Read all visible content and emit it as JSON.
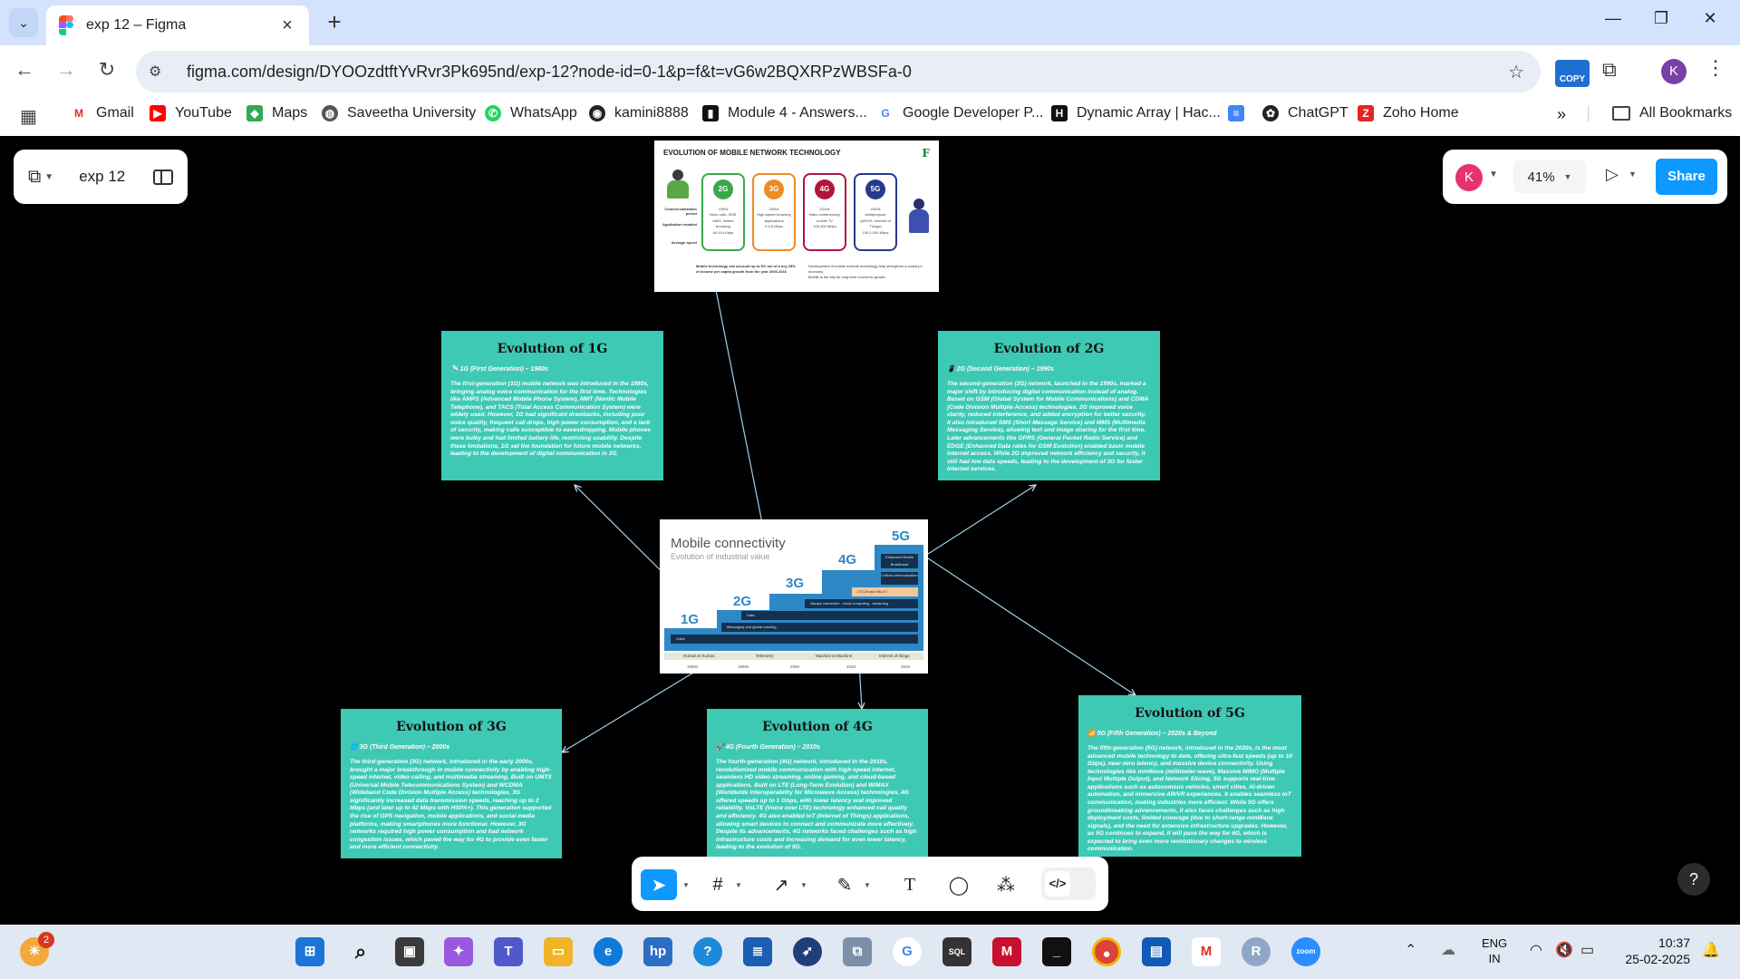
{
  "browser": {
    "tab_title": "exp 12 – Figma",
    "url": "figma.com/design/DYOOzdtftYvRvr3Pk695nd/exp-12?node-id=0-1&p=f&t=vG6w2BQXRPzWBSFa-0",
    "copy_extension_label": "COPY",
    "profile_initial": "K",
    "bookmarks": [
      "Gmail",
      "YouTube",
      "Maps",
      "Saveetha University",
      "WhatsApp",
      "kamini8888",
      "Module 4 - Answers...",
      "Google Developer P...",
      "Dynamic Array | Hac...",
      "ChatGPT",
      "Zoho Home"
    ],
    "all_bookmarks": "All Bookmarks"
  },
  "figma": {
    "file_name": "exp 12",
    "user_initial": "K",
    "zoom": "41%",
    "share_label": "Share",
    "help_label": "?"
  },
  "image_evolution": {
    "title": "EVOLUTION OF MOBILE NETWORK TECHNOLOGY",
    "row_labels": [
      "Commercialization period",
      "Application enabled",
      "Average speed"
    ],
    "generations": [
      {
        "badge": "2G",
        "period": "1990s",
        "apps": "Voice calls, SMS, MMS, limited browsing",
        "speed": "64-114 Kbps",
        "color": "#3aa84a"
      },
      {
        "badge": "3G",
        "period": "2000s",
        "apps": "High-speed browsing applications",
        "speed": "0.5-5 Mbps",
        "color": "#f08a24"
      },
      {
        "badge": "4G",
        "period": "2010s",
        "apps": "Video conferencing, mobile TV",
        "speed": "100-300 Mbps",
        "color": "#b0163a"
      },
      {
        "badge": "5G",
        "period": "2020s",
        "apps": "Multipurpose (AR/VR, Internet of Things)",
        "speed": "100-1,000 Mbps",
        "color": "#253a8c"
      }
    ],
    "note_left": "Mobile technology can account up to 5% out of a key 25% of income per capita growth from the year 2000-2016",
    "note_right_1": "Development of mobile network technology help strengthen a country's economy",
    "note_right_2": "Mobile is the key for long term economic growth"
  },
  "frame_1g": {
    "title": "Evolution of 1G",
    "subtitle": "📡 1G (First Generation) – 1980s",
    "body": "The first-generation (1G) mobile network was introduced in the 1980s, bringing analog voice communication for the first time. Technologies like AMPS (Advanced Mobile Phone System), NMT (Nordic Mobile Telephone), and TACS (Total Access Communication System) were widely used. However, 1G had significant drawbacks, including poor voice quality, frequent call drops, high power consumption, and a lack of security, making calls susceptible to eavesdropping. Mobile phones were bulky and had limited battery life, restricting usability. Despite these limitations, 1G set the foundation for future mobile networks, leading to the development of digital communication in 2G."
  },
  "frame_2g": {
    "title": "Evolution of 2G",
    "subtitle": "📱 2G (Second Generation) – 1990s",
    "body": "The second-generation (2G) network, launched in the 1990s, marked a major shift by introducing digital communication instead of analog. Based on GSM (Global System for Mobile Communications) and CDMA (Code Division Multiple Access) technologies, 2G improved voice clarity, reduced interference, and added encryption for better security. It also introduced SMS (Short Message Service) and MMS (Multimedia Messaging Service), allowing text and image sharing for the first time. Later advancements like GPRS (General Packet Radio Service) and EDGE (Enhanced Data rates for GSM Evolution) enabled basic mobile internet access. While 2G improved network efficiency and security, it still had low data speeds, leading to the development of 3G for faster internet services."
  },
  "frame_3g": {
    "title": "Evolution of 3G",
    "subtitle": "🌐 3G (Third Generation) – 2000s",
    "body": "The third-generation (3G) network, introduced in the early 2000s, brought a major breakthrough in mobile connectivity by enabling high-speed internet, video calling, and multimedia streaming. Built on UMTS (Universal Mobile Telecommunications System) and WCDMA (Wideband Code Division Multiple Access) technologies, 3G significantly increased data transmission speeds, reaching up to 2 Mbps (and later up to 42 Mbps with HSPA+). This generation supported the rise of GPS navigation, mobile applications, and social media platforms, making smartphones more functional. However, 3G networks required high power consumption and had network congestion issues, which paved the way for 4G to provide even faster and more efficient connectivity."
  },
  "frame_4g": {
    "title": "Evolution of 4G",
    "subtitle": "🚀 4G (Fourth Generation) – 2010s",
    "body": "The fourth-generation (4G) network, introduced in the 2010s, revolutionized mobile communication with high-speed internet, seamless HD video streaming, online gaming, and cloud-based applications. Built on LTE (Long-Term Evolution) and WiMAX (Worldwide Interoperability for Microwave Access) technologies, 4G offered speeds up to 1 Gbps, with lower latency and improved reliability. VoLTE (Voice over LTE) technology enhanced call quality and efficiency. 4G also enabled IoT (Internet of Things) applications, allowing smart devices to connect and communicate more effectively. Despite its advancements, 4G networks faced challenges such as high infrastructure costs and increasing demand for even lower latency, leading to the evolution of 5G."
  },
  "frame_5g": {
    "title": "Evolution of 5G",
    "subtitle": "📶 5G (Fifth Generation) – 2020s & Beyond",
    "body": "The fifth-generation (5G) network, introduced in the 2020s, is the most advanced mobile technology to date, offering ultra-fast speeds (up to 10 Gbps), near-zero latency, and massive device connectivity. Using technologies like mmWave (millimeter-wave), Massive MIMO (Multiple Input Multiple Output), and Network Slicing, 5G supports real-time applications such as autonomous vehicles, smart cities, AI-driven automation, and immersive AR/VR experiences. It enables seamless IoT communication, making industries more efficient. While 5G offers groundbreaking advancements, it also faces challenges such as high deployment costs, limited coverage (due to short-range mmWave signals), and the need for extensive infrastructure upgrades. However, as 5G continues to expand, it will pave the way for 6G, which is expected to bring even more revolutionary changes to wireless communication."
  },
  "image_connectivity": {
    "title": "Mobile connectivity",
    "subtitle": "Evolution of industrial value",
    "steps": [
      "1G",
      "2G",
      "3G",
      "4G",
      "5G"
    ],
    "bands": [
      "Voice",
      "Messaging and global roaming",
      "Data",
      "Always connected - cloud computing - streaming",
      "LTE-M and NB-IoT",
      "Critical communication",
      "Enhanced Mobile Broadband"
    ],
    "categories": [
      "Human to human",
      "Telemetry",
      "Machine to Machine",
      "Internet of things"
    ],
    "years": [
      "1980s",
      "1990s",
      "2000",
      "2010",
      "2025"
    ]
  },
  "taskbar": {
    "weather_badge": "2",
    "lang_1": "ENG",
    "lang_2": "IN",
    "time": "10:37",
    "date": "25-02-2025"
  }
}
